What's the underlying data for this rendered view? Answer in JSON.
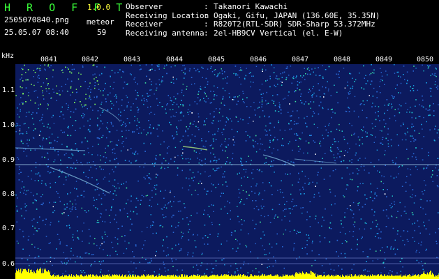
{
  "header": {
    "app_name": "H R O F F T",
    "version": "1.0.0",
    "filename": "2505070840.png",
    "meteor_label": "meteor",
    "datetime": "25.05.07 08:40",
    "meteor_count": "59"
  },
  "meta": [
    {
      "key": "Observer",
      "value": "Takanori Kawachi"
    },
    {
      "key": "Receiving Location",
      "value": "Ogaki, Gifu, JAPAN (136.60E, 35.35N)"
    },
    {
      "key": "Receiver",
      "value": "R820T2(RTL-SDR) SDR-Sharp 53.372MHz"
    },
    {
      "key": "Receiving antenna",
      "value": "2el-HB9CV Vertical (el. E-W)"
    }
  ],
  "axis": {
    "unit": "kHz",
    "time_ticks": [
      "0841",
      "0842",
      "0843",
      "0844",
      "0845",
      "0846",
      "0847",
      "0848",
      "0849",
      "0850"
    ],
    "freq_ticks": [
      "1.1",
      "1.0",
      "0.9",
      "0.8",
      "0.7",
      "0.6"
    ]
  },
  "colors": {
    "brand": "#3aff3a",
    "version": "#ffff3a",
    "background": "#0c1a5e",
    "signal": "#ffff00"
  }
}
